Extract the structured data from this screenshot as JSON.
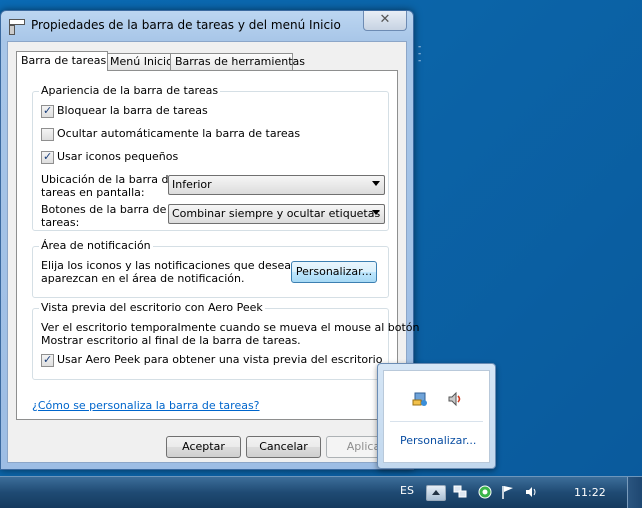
{
  "window": {
    "title": "Propiedades de la barra de tareas y del menú Inicio",
    "close_glyph": "✕"
  },
  "tabs": [
    {
      "label": "Barra de tareas",
      "active": true
    },
    {
      "label": "Menú Inicio",
      "active": false
    },
    {
      "label": "Barras de herramientas",
      "active": false
    }
  ],
  "appearance": {
    "legend": "Apariencia de la barra de tareas",
    "lock": {
      "label": "Bloquear la barra de tareas",
      "checked": true
    },
    "autohide": {
      "label": "Ocultar automáticamente la barra de tareas",
      "checked": false
    },
    "small_icons": {
      "label": "Usar iconos pequeños",
      "checked": true
    },
    "location": {
      "label_line1": "Ubicación de la barra de",
      "label_line2": "tareas en pantalla:",
      "value": "Inferior"
    },
    "buttons": {
      "label_line1": "Botones de la barra de",
      "label_line2": "tareas:",
      "value": "Combinar siempre y ocultar etiquetas"
    }
  },
  "notification": {
    "legend": "Área de notificación",
    "text_line1": "Elija los iconos y las notificaciones que desea que",
    "text_line2": "aparezcan en el área de notificación.",
    "customize_button": "Personalizar..."
  },
  "aero_peek": {
    "legend": "Vista previa del escritorio con Aero Peek",
    "text_line1": "Ver el escritorio temporalmente cuando se mueva el mouse al botón",
    "text_line2": "Mostrar escritorio al final de la barra de tareas.",
    "use_peek": {
      "label": "Usar Aero Peek para obtener una vista previa del escritorio",
      "checked": true
    }
  },
  "help_link": "¿Cómo se personaliza la barra de tareas?",
  "footer": {
    "ok": "Aceptar",
    "cancel": "Cancelar",
    "apply": "Aplica"
  },
  "tray_popup": {
    "icons": [
      "network-sharing-icon",
      "speaker-muted-icon"
    ],
    "customize_link": "Personalizar..."
  },
  "taskbar": {
    "language": "ES",
    "clock": "11:22",
    "tray_icons": [
      "show-hidden-icons-icon",
      "network-icon",
      "green-circle-icon",
      "flag-icon",
      "volume-icon"
    ]
  },
  "colors": {
    "desktop": "#0b64a8",
    "link": "#0066cc",
    "taskbar": "#1f4a73"
  }
}
